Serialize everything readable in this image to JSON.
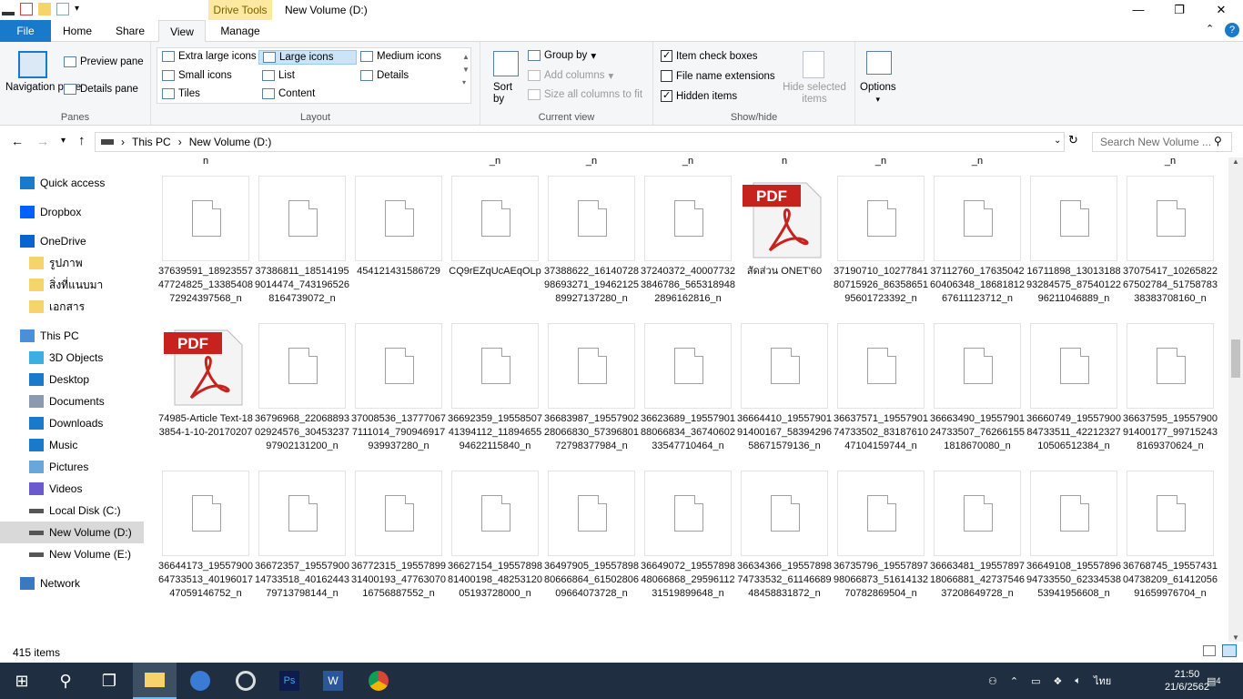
{
  "window": {
    "title": "New Volume (D:)",
    "context_tab": "Drive Tools"
  },
  "tabs": [
    {
      "label": "File"
    },
    {
      "label": "Home"
    },
    {
      "label": "Share"
    },
    {
      "label": "View"
    },
    {
      "label": "Manage"
    }
  ],
  "ribbon": {
    "panes": {
      "navigation_pane": "Navigation pane",
      "preview_pane": "Preview pane",
      "details_pane": "Details pane",
      "caption": "Panes"
    },
    "layout": {
      "extra_large": "Extra large icons",
      "large": "Large icons",
      "medium": "Medium icons",
      "small": "Small icons",
      "list": "List",
      "details": "Details",
      "tiles": "Tiles",
      "content": "Content",
      "caption": "Layout"
    },
    "current_view": {
      "sort_by": "Sort by",
      "group_by": "Group by",
      "add_columns": "Add columns",
      "size_columns": "Size all columns to fit",
      "caption": "Current view"
    },
    "show_hide": {
      "item_check_boxes": "Item check boxes",
      "file_name_extensions": "File name extensions",
      "hidden_items": "Hidden items",
      "hide_selected": "Hide selected items",
      "caption": "Show/hide"
    },
    "options": "Options"
  },
  "address": {
    "crumbs": [
      "This PC",
      "New Volume (D:)"
    ],
    "search_placeholder": "Search New Volume ..."
  },
  "nav": [
    {
      "label": "Quick access",
      "icon": "star-icon"
    },
    {
      "label": "Dropbox",
      "icon": "dropbox-icon"
    },
    {
      "label": "OneDrive",
      "icon": "cloud-icon"
    },
    {
      "label": "รูปภาพ",
      "icon": "folder-icon"
    },
    {
      "label": "สิ่งที่แนบมา",
      "icon": "folder-icon"
    },
    {
      "label": "เอกสาร",
      "icon": "folder-icon"
    },
    {
      "label": "This PC",
      "icon": "computer-icon"
    },
    {
      "label": "3D Objects",
      "icon": "cube-icon"
    },
    {
      "label": "Desktop",
      "icon": "desktop-icon"
    },
    {
      "label": "Documents",
      "icon": "document-icon"
    },
    {
      "label": "Downloads",
      "icon": "download-icon"
    },
    {
      "label": "Music",
      "icon": "music-icon"
    },
    {
      "label": "Pictures",
      "icon": "picture-icon"
    },
    {
      "label": "Videos",
      "icon": "video-icon"
    },
    {
      "label": "Local Disk (C:)",
      "icon": "drive-icon"
    },
    {
      "label": "New Volume (D:)",
      "icon": "drive-icon"
    },
    {
      "label": "New Volume (E:)",
      "icon": "drive-icon"
    },
    {
      "label": "Network",
      "icon": "network-icon"
    }
  ],
  "top_labels": [
    "n",
    "",
    "",
    "_n",
    "_n",
    "_n",
    "n",
    "_n",
    "_n",
    "",
    "_n"
  ],
  "files": [
    {
      "name": "37639591_1892355747724825_1338540872924397568_n",
      "type": "file"
    },
    {
      "name": "37386811_185141959014474_7431965268164739072_n",
      "type": "file"
    },
    {
      "name": "454121431586729",
      "type": "file"
    },
    {
      "name": "CQ9rEZqUcAEqOLp",
      "type": "file"
    },
    {
      "name": "37388622_1614072898693271_1946212589927137280_n",
      "type": "file"
    },
    {
      "name": "37240372_400077323846786_5653189482896162816_n",
      "type": "file"
    },
    {
      "name": "สัดส่วน ONET'60",
      "type": "pdf"
    },
    {
      "name": "37190710_1027784180715926_8635865195601723392_n",
      "type": "file"
    },
    {
      "name": "37112760_1763504260406348_1868181267611123712_n",
      "type": "file"
    },
    {
      "name": "16711898_1301318893284575_8754012296211046889_n",
      "type": "file"
    },
    {
      "name": "37075417_1026582267502784_5175878338383708160_n",
      "type": "file"
    },
    {
      "name": "74985-Article Text-183854-1-10-20170207",
      "type": "pdf"
    },
    {
      "name": "36796968_2206889302924576_3045323797902131200_n",
      "type": "file"
    },
    {
      "name": "37008536_137770677111014_790946917939937280_n",
      "type": "file"
    },
    {
      "name": "36692359_1955850741394112_1189465594622115840_n",
      "type": "file"
    },
    {
      "name": "36683987_1955790228066830_5739680172798377984_n",
      "type": "file"
    },
    {
      "name": "36623689_1955790188066834_3674060233547710464_n",
      "type": "file"
    },
    {
      "name": "36664410_1955790191400167_5839429658671579136_n",
      "type": "file"
    },
    {
      "name": "36637571_1955790174733502_8318761047104159744_n",
      "type": "file"
    },
    {
      "name": "36663490_1955790124733507_762661551818670080_n",
      "type": "file"
    },
    {
      "name": "36660749_1955790084733511_4221232710506512384_n",
      "type": "file"
    },
    {
      "name": "36637595_1955790091400177_997152438169370624_n",
      "type": "file"
    },
    {
      "name": "36644173_1955790064733513_4019601747059146752_n",
      "type": "file"
    },
    {
      "name": "36672357_1955790014733518_4016244379713798144_n",
      "type": "file"
    },
    {
      "name": "36772315_1955789931400193_4776307016756887552_n",
      "type": "file"
    },
    {
      "name": "36627154_1955789881400198_4825312005193728000_n",
      "type": "file"
    },
    {
      "name": "36497905_1955789880666864_6150280609664073728_n",
      "type": "file"
    },
    {
      "name": "36649072_1955789848066868_2959611231519899648_n",
      "type": "file"
    },
    {
      "name": "36634366_1955789874733532_6114668948458831872_n",
      "type": "file"
    },
    {
      "name": "36735796_1955789798066873_5161413270782869504_n",
      "type": "file"
    },
    {
      "name": "36663481_1955789718066881_4273754637208649728_n",
      "type": "file"
    },
    {
      "name": "36649108_1955789694733550_6233453853941956608_n",
      "type": "file"
    },
    {
      "name": "36768745_1955743104738209_6141205691659976704_n",
      "type": "file"
    }
  ],
  "status": {
    "count": "415 items"
  },
  "taskbar": {
    "time": "21:50",
    "date": "21/6/2562",
    "lang": "ไทย",
    "notif_count": "4"
  }
}
